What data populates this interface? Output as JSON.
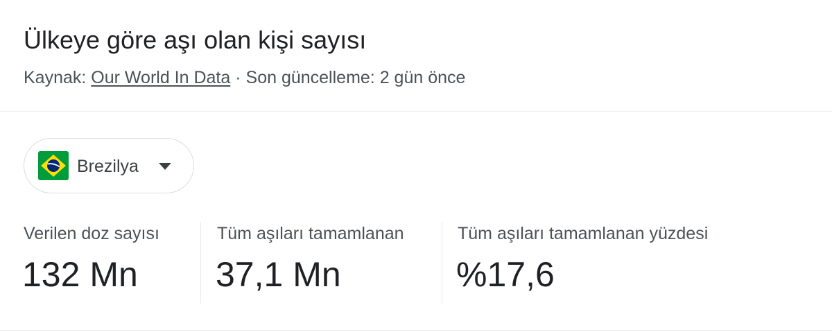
{
  "header": {
    "title": "Ülkeye göre aşı olan kişi sayısı",
    "source_prefix": "Kaynak: ",
    "source_link": "Our World In Data",
    "separator": " · ",
    "updated": "Son güncelleme: 2 gün önce"
  },
  "country_selector": {
    "selected": "Brezilya",
    "flag_icon": "brazil-flag-icon",
    "dropdown_icon": "caret-down-icon"
  },
  "stats": [
    {
      "label": "Verilen doz sayısı",
      "value": "132 Mn"
    },
    {
      "label": "Tüm aşıları tamamlanan",
      "value": "37,1 Mn"
    },
    {
      "label": "Tüm aşıları tamamlanan yüzdesi",
      "value": "%17,6"
    }
  ],
  "colors": {
    "text_primary": "#202124",
    "text_secondary": "#4d5156",
    "divider": "#e8eaed",
    "flag_green": "#009b3a",
    "flag_yellow": "#fedf00",
    "flag_blue": "#002776"
  }
}
